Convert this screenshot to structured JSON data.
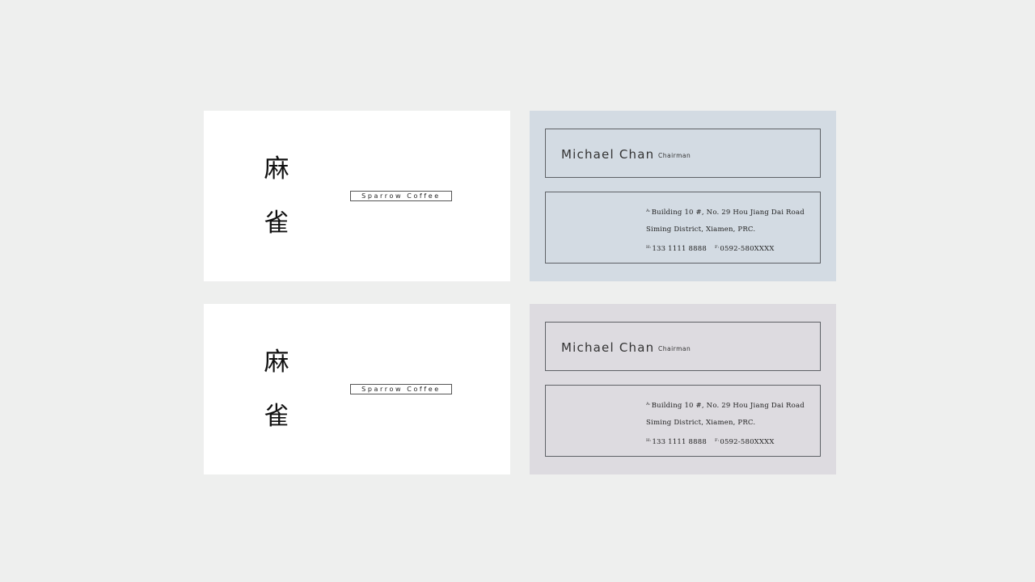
{
  "cards": [
    {
      "front": {
        "logo_chars": [
          "麻",
          "雀"
        ],
        "brand": "Sparrow Coffee"
      },
      "back": {
        "color": "#d3dbe3",
        "name": "Michael Chan",
        "title": "Chairman",
        "address_label": "A:",
        "address_line1": "Building 10 #, No. 29 Hou Jiang Dai Road",
        "address_line2": "Siming District, Xiamen, PRC.",
        "phone_label": "H:",
        "phone": "133 1111 8888",
        "fax_label": "F:",
        "fax": "0592-580XXXX"
      }
    },
    {
      "front": {
        "logo_chars": [
          "麻",
          "雀"
        ],
        "brand": "Sparrow Coffee"
      },
      "back": {
        "color": "#dddbe0",
        "name": "Michael Chan",
        "title": "Chairman",
        "address_label": "A:",
        "address_line1": "Building 10 #, No. 29 Hou Jiang Dai Road",
        "address_line2": "Siming District, Xiamen, PRC.",
        "phone_label": "H:",
        "phone": "133 1111 8888",
        "fax_label": "F:",
        "fax": "0592-580XXXX"
      }
    }
  ],
  "colors": {
    "page_background": "#eeefee",
    "front_background": "#ffffff",
    "border": "#5e6166"
  }
}
